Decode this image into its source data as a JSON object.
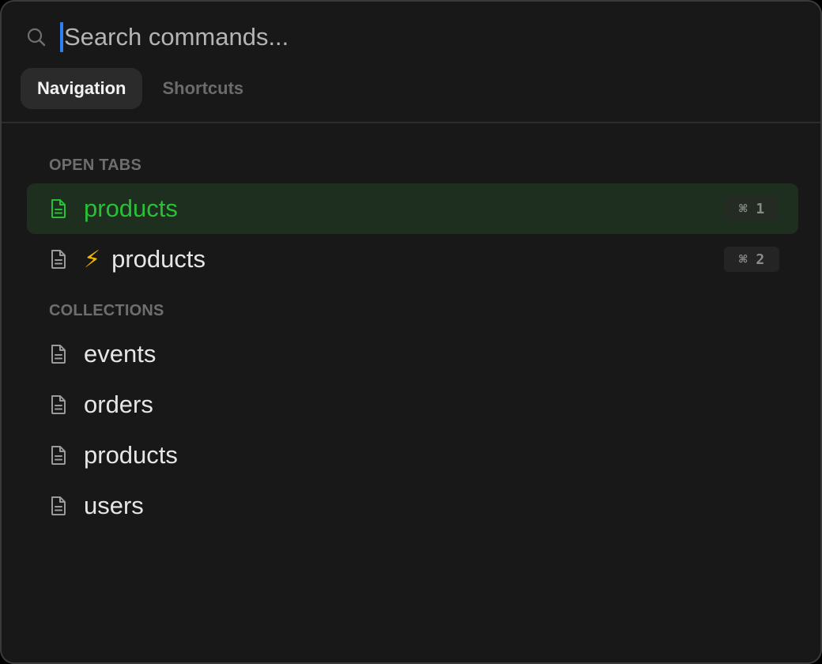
{
  "search": {
    "placeholder": "Search commands...",
    "value": ""
  },
  "tabs": [
    {
      "label": "Navigation",
      "active": true
    },
    {
      "label": "Shortcuts",
      "active": false
    }
  ],
  "sections": {
    "open_tabs": {
      "heading": "OPEN TABS",
      "items": [
        {
          "label": "products",
          "icon": "file-icon",
          "shortcut": "⌘ 1",
          "selected": true
        },
        {
          "label": "products",
          "icon": "file-icon",
          "prefix_icon": "⚡",
          "shortcut": "⌘ 2",
          "selected": false
        }
      ]
    },
    "collections": {
      "heading": "COLLECTIONS",
      "items": [
        {
          "label": "events",
          "icon": "file-icon"
        },
        {
          "label": "orders",
          "icon": "file-icon"
        },
        {
          "label": "products",
          "icon": "file-icon"
        },
        {
          "label": "users",
          "icon": "file-icon"
        }
      ]
    }
  },
  "colors": {
    "background": "#181818",
    "accent_green": "#27c136",
    "selected_row_bg": "#1e2f1f",
    "caret": "#2f7ff0",
    "bolt": "#f2b705"
  }
}
